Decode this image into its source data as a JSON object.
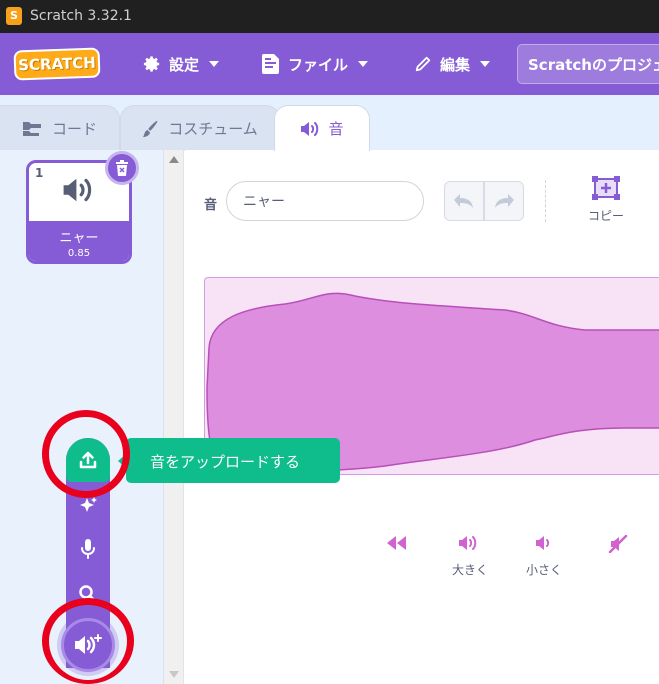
{
  "window": {
    "title": "Scratch 3.32.1"
  },
  "menubar": {
    "logo_text": "SCRATCH",
    "settings_label": "設定",
    "file_label": "ファイル",
    "edit_label": "編集",
    "project_title": "Scratchのプロジェクト"
  },
  "tabs": [
    {
      "label": "コード",
      "active": false
    },
    {
      "label": "コスチューム",
      "active": false
    },
    {
      "label": "音",
      "active": true
    }
  ],
  "sound_list": [
    {
      "number": "1",
      "name": "ニャー",
      "duration": "0.85"
    }
  ],
  "editor": {
    "sound_label": "音",
    "sound_name": "ニャー",
    "copy_label": "コピー"
  },
  "effects": [
    {
      "icon": "faster-icon",
      "label": ""
    },
    {
      "icon": "louder-icon",
      "label": "大きく"
    },
    {
      "icon": "softer-icon",
      "label": "小さく"
    },
    {
      "icon": "mute-icon",
      "label": ""
    }
  ],
  "add_sound_menu": {
    "upload_tooltip": "音をアップロードする",
    "items": [
      "upload-icon",
      "surprise-icon",
      "record-icon",
      "search-icon"
    ],
    "main_button_icon": "add-sound-icon"
  },
  "colors": {
    "accent": "#855cd6",
    "upload_green": "#0fbd8c",
    "waveform_fill": "#de8ede",
    "highlight": "#e8001c"
  }
}
